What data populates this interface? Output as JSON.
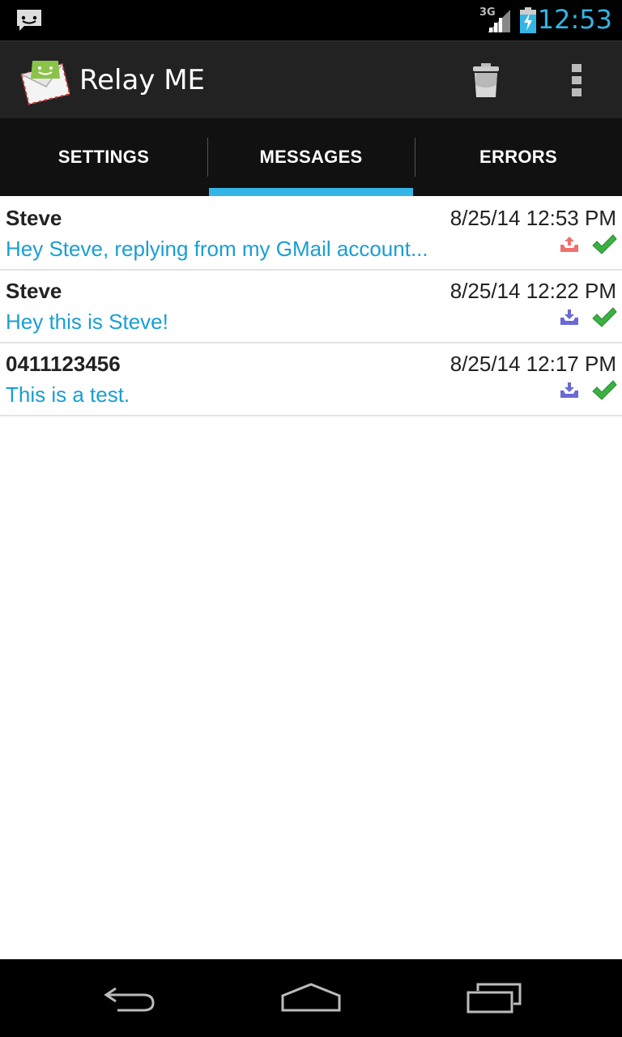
{
  "status_bar": {
    "network_label": "3G",
    "time": "12:53",
    "icons": [
      "sms-notification-icon",
      "signal-icon",
      "battery-charging-icon"
    ]
  },
  "action_bar": {
    "title": "Relay ME",
    "icons": [
      "app-logo-icon",
      "trash-icon",
      "overflow-menu-icon"
    ]
  },
  "tabs": [
    {
      "label": "SETTINGS",
      "active": false
    },
    {
      "label": "MESSAGES",
      "active": true
    },
    {
      "label": "ERRORS",
      "active": false
    }
  ],
  "messages": [
    {
      "sender": "Steve",
      "timestamp": "8/25/14 12:53 PM",
      "text": "Hey Steve, replying from my GMail account...",
      "direction": "outgoing",
      "direction_color": "#f07070",
      "status": "delivered"
    },
    {
      "sender": "Steve",
      "timestamp": "8/25/14 12:22 PM",
      "text": "Hey this is Steve!",
      "direction": "incoming",
      "direction_color": "#6a6ad6",
      "status": "delivered"
    },
    {
      "sender": "0411123456",
      "timestamp": "8/25/14 12:17 PM",
      "text": "This is a test.",
      "direction": "incoming",
      "direction_color": "#6a6ad6",
      "status": "delivered"
    }
  ],
  "nav_bar": {
    "icons": [
      "back-icon",
      "home-icon",
      "recent-apps-icon"
    ]
  },
  "colors": {
    "accent": "#33b5e5",
    "message_text": "#1a9ed2",
    "check": "#3cb043"
  }
}
